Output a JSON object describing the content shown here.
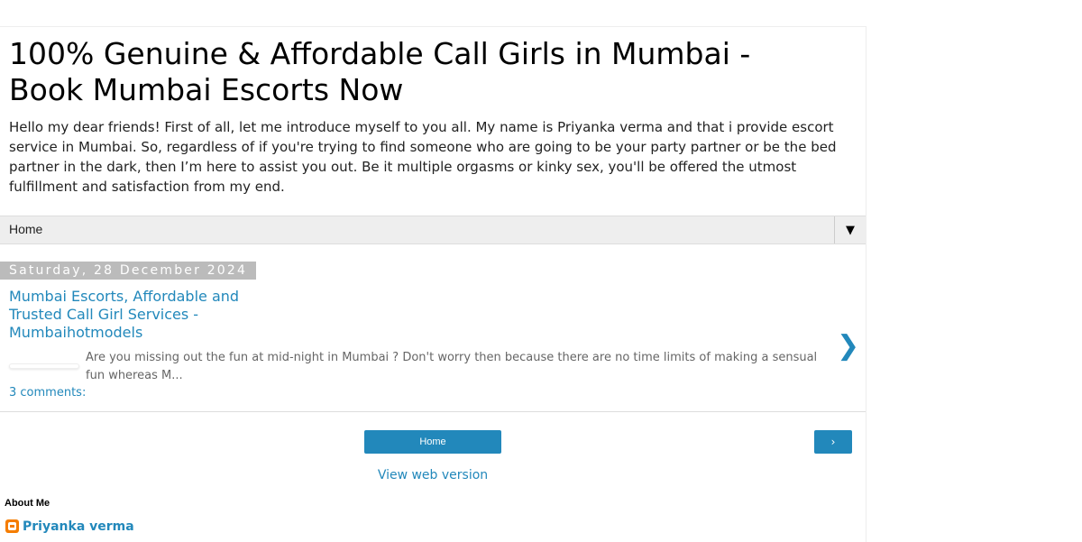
{
  "header": {
    "title": "100% Genuine & Affordable Call Girls in Mumbai - Book Mumbai Escorts Now",
    "description": "Hello my dear friends! First of all, let me introduce myself to you all. My name is Priyanka verma and that i provide escort service in Mumbai. So, regardless of if you're trying to find someone who are going to be your party partner or be the bed partner in the dark, then I’m here to assist you out. Be it multiple orgasms or kinky sex, you'll be offered the utmost fulfillment and satisfaction from my end."
  },
  "nav": {
    "home_label": "Home",
    "dropdown_glyph": "▼"
  },
  "post": {
    "date": "Saturday, 28 December 2024",
    "title": "Mumbai Escorts, Affordable and Trusted Call Girl Services - Mumbaihotmodels",
    "snippet": "Are you missing out the fun at mid-night in Mumbai ? Don't worry then because there are no time limits of making a sensual fun whereas M...",
    "arrow_glyph": "❯",
    "comments": "3 comments:"
  },
  "pager": {
    "home_label": "Home",
    "older_glyph": "›"
  },
  "footer": {
    "web_version": "View web version"
  },
  "profile": {
    "section_title": "About Me",
    "name": "Priyanka verma",
    "icon": "blogger-icon"
  },
  "colors": {
    "link": "#2288bb",
    "date_bg": "#bbbbbb",
    "nav_bg": "#eeeeee"
  }
}
